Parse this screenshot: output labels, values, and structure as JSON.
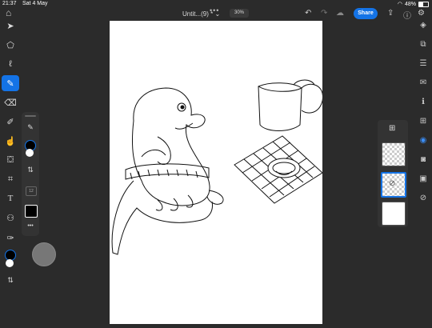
{
  "status": {
    "time": "21:37",
    "date": "Sat 4 May",
    "battery": "48%"
  },
  "document": {
    "title": "Untit...(9) *",
    "zoom": "30%",
    "share_label": "Share"
  },
  "left_toolbar": {
    "tools": [
      "select-tool",
      "transform-tool",
      "lasso-tool",
      "brush-tool",
      "eraser-tool",
      "smudge-tool",
      "liquify-tool",
      "fill-tool",
      "crop-tool",
      "text-tool",
      "adjust-tool",
      "eyedropper-tool"
    ],
    "active": "brush-tool",
    "swap_icon": "swap-arrows-icon"
  },
  "brush_panel": {
    "size_label": "12",
    "more_label": "•••",
    "primary_color": "#000000",
    "secondary_color": "#ffffff"
  },
  "right_toolbar": {
    "tools": [
      "layers-tool",
      "layer-properties-tool",
      "adjustments-tool",
      "comments-tool",
      "info-tool",
      "add-layer-tool",
      "visibility-tool",
      "mask-tool",
      "fx-tool",
      "paint-tool"
    ],
    "active": "visibility-tool"
  },
  "layers_panel": {
    "count": 3,
    "selected_index": 1
  },
  "colors": {
    "accent": "#1473e6",
    "app_bg": "#2b2b2b",
    "panel_bg": "#333333"
  }
}
